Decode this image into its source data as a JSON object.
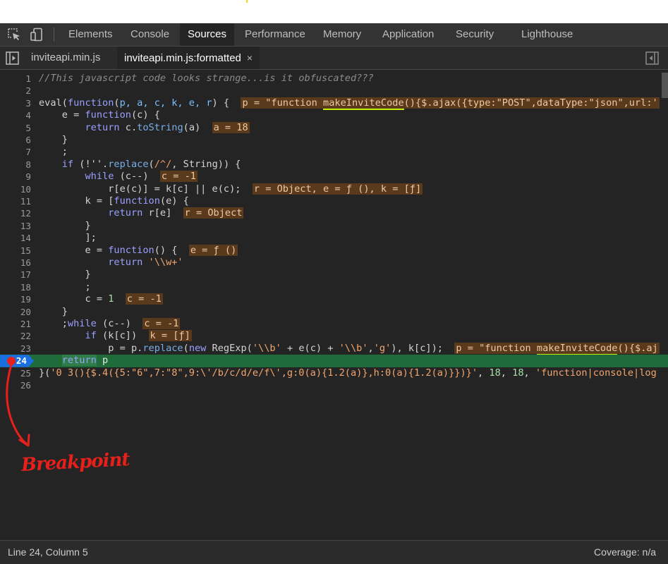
{
  "devtools": {
    "main_tabs": [
      {
        "label": "Elements"
      },
      {
        "label": "Console"
      },
      {
        "label": "Sources",
        "active": true
      },
      {
        "label": "Performance"
      },
      {
        "label": "Memory"
      },
      {
        "label": "Application"
      },
      {
        "label": "Security"
      },
      {
        "label": "Lighthouse"
      }
    ],
    "icons": {
      "inspect": "inspect-element-icon",
      "device": "device-toolbar-icon",
      "navigator": "toggle-navigator-icon",
      "debugger": "toggle-debugger-icon"
    }
  },
  "files": {
    "tabs": [
      {
        "label": "inviteapi.min.js"
      },
      {
        "label": "inviteapi.min.js:formatted",
        "active": true,
        "close": "×"
      }
    ]
  },
  "editor": {
    "breakpoint_line": 24,
    "line_numbers": [
      "1",
      "2",
      "3",
      "4",
      "5",
      "6",
      "7",
      "8",
      "9",
      "10",
      "11",
      "12",
      "13",
      "14",
      "15",
      "16",
      "17",
      "18",
      "19",
      "20",
      "21",
      "22",
      "23",
      "24",
      "25",
      "26"
    ],
    "code": {
      "l1": "//This javascript code looks strange...is it obfuscated???",
      "l3a": "eval(",
      "l3b": "function",
      "l3c": "(",
      "l3p": "p, a, c, k, e, r",
      "l3d": ") {  ",
      "l3badge_a": "p = \"function ",
      "l3badge_fn": "makeInviteCode",
      "l3badge_b": "(){$.ajax({type:\"POST\",dataType:\"json\",url:'",
      "l4a": "    e = ",
      "l4b": "function",
      "l4c": "(c) {",
      "l5a": "        ",
      "l5b": "return",
      "l5c": " c.",
      "l5d": "toString",
      "l5e": "(a)  ",
      "l5badge": "a = 18",
      "l6": "    }",
      "l7": "    ;",
      "l8a": "    ",
      "l8b": "if",
      "l8c": " (!''.",
      "l8d": "replace",
      "l8e": "(",
      "l8f": "/^/",
      "l8g": ", String)) {",
      "l9a": "        ",
      "l9b": "while",
      "l9c": " (c--)  ",
      "l9badge": "c = -1",
      "l10a": "            r[e(c)] = k[c] || e(c);  ",
      "l10badge": "r = Object, e = ƒ (), k = [ƒ]",
      "l11a": "        k = [",
      "l11b": "function",
      "l11c": "(e) {",
      "l12a": "            ",
      "l12b": "return",
      "l12c": " r[e]  ",
      "l12badge": "r = Object",
      "l13": "        }",
      "l14": "        ];",
      "l15a": "        e = ",
      "l15b": "function",
      "l15c": "() {  ",
      "l15badge": "e = ƒ ()",
      "l16a": "            ",
      "l16b": "return",
      "l16c": " ",
      "l16d": "'\\\\w+'",
      "l17": "        }",
      "l18": "        ;",
      "l19a": "        c = ",
      "l19b": "1",
      "l19c": "  ",
      "l19badge": "c = -1",
      "l20": "    }",
      "l21a": "    ;",
      "l21b": "while",
      "l21c": " (c--)  ",
      "l21badge": "c = -1",
      "l22a": "        ",
      "l22b": "if",
      "l22c": " (k[c])  ",
      "l22badge": "k = [ƒ]",
      "l23a": "            p = p.",
      "l23b": "replace",
      "l23c": "(",
      "l23d": "new",
      "l23e": " RegExp(",
      "l23f": "'\\\\b'",
      "l23g": " + e(c) + ",
      "l23h": "'\\\\b'",
      "l23i": ",",
      "l23j": "'g'",
      "l23k": "), k[c]);  ",
      "l23badge_a": "p = \"function ",
      "l23badge_fn": "makeInviteCode",
      "l23badge_b": "(){$.aj",
      "l24a": "    ",
      "l24b": "return",
      "l24c": " p",
      "l25a": "}(",
      "l25b": "'0 3(){$.4({5:\"6\",7:\"8\",9:\\'/b/c/d/e/f\\',g:0(a){1.2(a)},h:0(a){1.2(a)}})}'",
      "l25c": ", ",
      "l25d": "18",
      "l25e": ", ",
      "l25f": "18",
      "l25g": ", ",
      "l25h": "'function|console|log"
    }
  },
  "status": {
    "position": "Line 24, Column 5",
    "coverage": "Coverage: n/a"
  },
  "annotation": {
    "label": "Breakpoint",
    "color": "#e8201c"
  }
}
